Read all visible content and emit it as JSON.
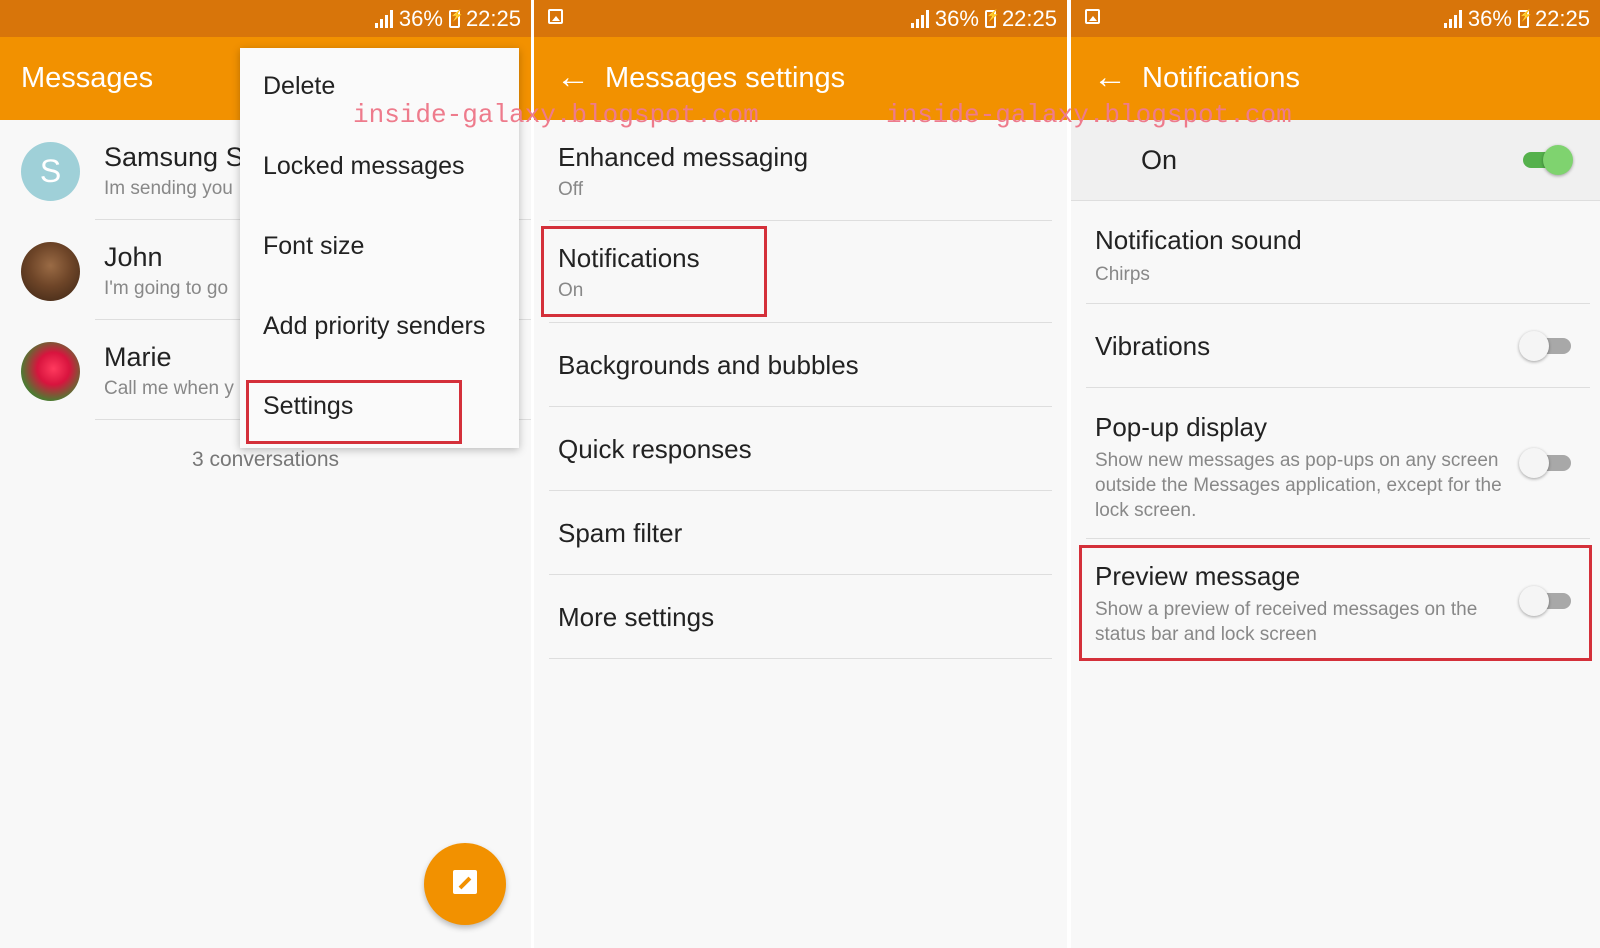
{
  "status": {
    "battery": "36%",
    "time": "22:25"
  },
  "watermark": "inside-galaxy.blogspot.com",
  "messages": {
    "title": "Messages",
    "conversations": [
      {
        "name": "Samsung S",
        "preview": "Im sending you",
        "avatar_letter": "S"
      },
      {
        "name": "John",
        "preview": "I'm going to go"
      },
      {
        "name": "Marie",
        "preview": "Call me when y"
      }
    ],
    "count": "3 conversations",
    "menu": [
      "Delete",
      "Locked messages",
      "Font size",
      "Add priority senders",
      "Settings"
    ]
  },
  "settings": {
    "title": "Messages settings",
    "items": [
      {
        "title": "Enhanced messaging",
        "sub": "Off"
      },
      {
        "title": "Notifications",
        "sub": "On"
      },
      {
        "title": "Backgrounds and bubbles"
      },
      {
        "title": "Quick responses"
      },
      {
        "title": "Spam filter"
      },
      {
        "title": "More settings"
      }
    ]
  },
  "notifications": {
    "title": "Notifications",
    "master": {
      "label": "On",
      "enabled": true
    },
    "items": [
      {
        "title": "Notification sound",
        "sub": "Chirps"
      },
      {
        "title": "Vibrations",
        "enabled": false
      },
      {
        "title": "Pop-up display",
        "sub": "Show new messages as pop-ups on any screen outside the Messages application, except for the lock screen.",
        "enabled": false
      },
      {
        "title": "Preview message",
        "sub": "Show a preview of received messages on the status bar and lock screen",
        "enabled": false
      }
    ]
  },
  "colors": {
    "status_bar": "#d8750a",
    "app_bar": "#f29100",
    "highlight": "#d4303a",
    "toggle_on": "#55b14c",
    "watermark": "#ee7b8c"
  }
}
